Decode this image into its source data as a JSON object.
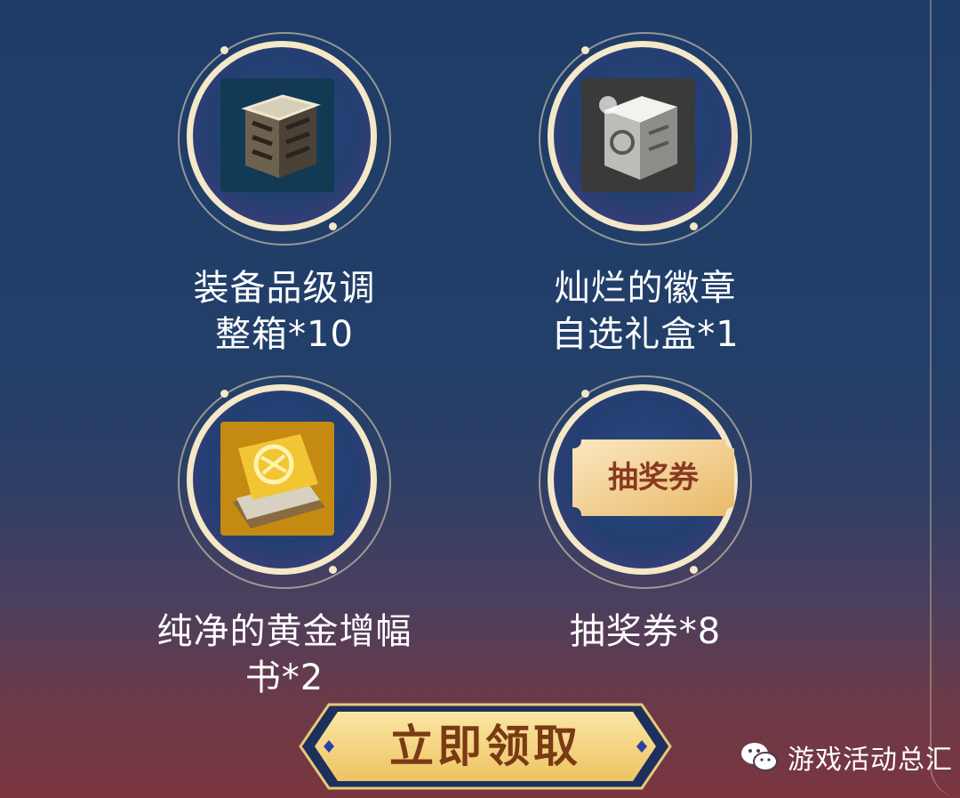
{
  "rewards": [
    {
      "line1": "装备品级调",
      "line2": "整箱*10"
    },
    {
      "line1": "灿烂的徽章",
      "line2": "自选礼盒*1"
    },
    {
      "line1": "纯净的黄金增幅",
      "line2": "书*2"
    },
    {
      "line1": "抽奖券*8",
      "line2": ""
    }
  ],
  "ticket_icon_text": "抽奖券",
  "claim_button": "立即领取",
  "watermark": "游戏活动总汇",
  "colors": {
    "background_top": "#1f3c68",
    "background_bottom": "#7a3540",
    "ring": "#f4e8c8",
    "button_gold": "#f3d37a",
    "button_text": "#7a3a16"
  }
}
